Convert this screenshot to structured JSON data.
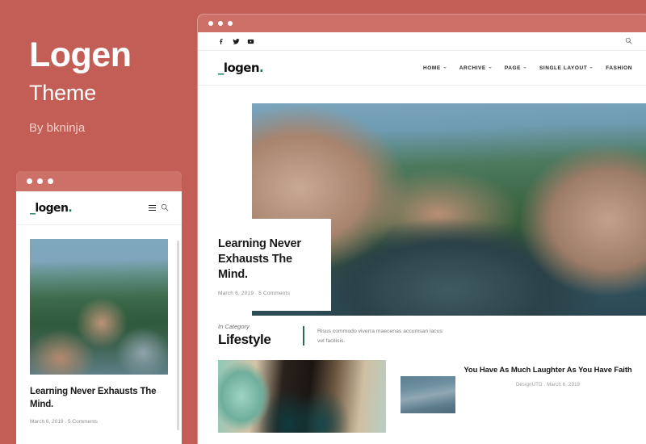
{
  "promo": {
    "title": "Logen",
    "subtitle": "Theme",
    "author": "By bkninja"
  },
  "brand": {
    "logo_prefix": "_",
    "logo_text": "logen",
    "logo_dot": ".",
    "accent_green": "#0d7a54",
    "accent_salmon": "#c25e55",
    "chrome_bar": "#cc7068"
  },
  "desktop": {
    "window_dots": [
      "dot-1",
      "dot-2",
      "dot-3"
    ],
    "topbar": {
      "socials": [
        {
          "name": "facebook-icon",
          "label": "Facebook"
        },
        {
          "name": "twitter-icon",
          "label": "Twitter"
        },
        {
          "name": "youtube-icon",
          "label": "YouTube"
        }
      ],
      "search_icon": "search-icon"
    },
    "nav": [
      {
        "label": "HOME",
        "has_caret": true
      },
      {
        "label": "ARCHIVE",
        "has_caret": true
      },
      {
        "label": "PAGE",
        "has_caret": true
      },
      {
        "label": "SINGLE LAYOUT",
        "has_caret": true
      },
      {
        "label": "FASHION",
        "has_caret": false
      }
    ],
    "hero": {
      "image_alt": "woman-sitting-by-jungle-pool",
      "title": "Learning Never Exhausts The Mind.",
      "meta": "March 6, 2019 . 5 Comments"
    },
    "category": {
      "kicker": "In Category",
      "name": "Lifestyle",
      "description": "Risus commodo viverra maecenas accumsan lacus vel facilisis."
    },
    "posts": [
      {
        "image_alt": "two-people-teal-doorway",
        "title": "",
        "meta": ""
      },
      {
        "image_alt": "blue-grey-sky",
        "title": "You Have As Much Laughter As You Have Faith",
        "meta": "DesignUTD . March 6, 2019"
      }
    ]
  },
  "mobile": {
    "window_dots": [
      "dot-1",
      "dot-2",
      "dot-3"
    ],
    "menu_icon": "hamburger-icon",
    "search_icon": "search-icon",
    "post": {
      "image_alt": "woman-sitting-by-jungle-pool",
      "title": "Learning Never Exhausts The Mind.",
      "meta": "March 6, 2019 . 5 Comments"
    }
  }
}
